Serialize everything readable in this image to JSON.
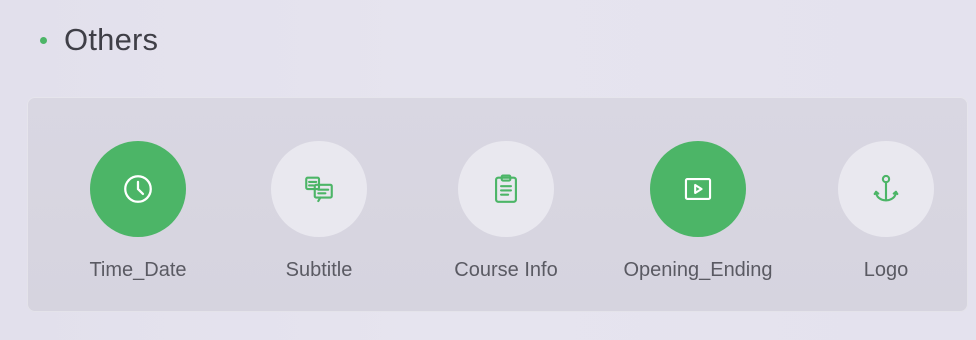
{
  "section": {
    "title": "Others"
  },
  "items": [
    {
      "label": "Time_Date",
      "icon": "clock-icon",
      "selected": true
    },
    {
      "label": "Subtitle",
      "icon": "subtitle-icon",
      "selected": false
    },
    {
      "label": "Course Info",
      "icon": "clipboard-icon",
      "selected": false
    },
    {
      "label": "Opening_Ending",
      "icon": "play-icon",
      "selected": true
    },
    {
      "label": "Logo",
      "icon": "anchor-icon",
      "selected": false
    }
  ],
  "colors": {
    "accent": "#4cb567",
    "icon_inactive": "#4cb567",
    "icon_active": "#ffffff"
  }
}
